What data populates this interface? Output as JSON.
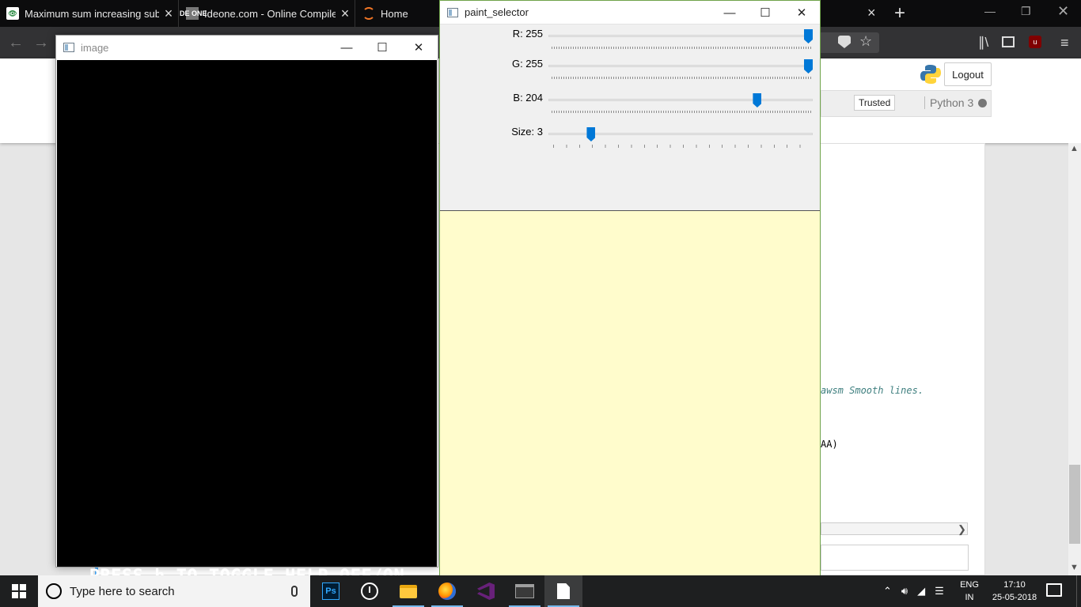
{
  "browser": {
    "tabs": [
      {
        "label": "Maximum sum increasing subs",
        "favicon": "gfg-icon"
      },
      {
        "label": "Ideone.com - Online Compiler",
        "favicon": "ideone-icon"
      },
      {
        "label": "Home",
        "favicon": "jupyter-icon"
      }
    ],
    "tab_close_glyph": "×",
    "new_tab_glyph": "+",
    "ideone_favicon_text": "IDE ONE"
  },
  "jupyter": {
    "logout_label": "Logout",
    "trusted_label": "Trusted",
    "kernel_name": "Python 3",
    "code_comment": "awsm Smooth lines.",
    "code_fragment": "AA)"
  },
  "image_window": {
    "title": "image",
    "help_text": "PRESS h TO TOGGLE  HELP OFF/ON",
    "canvas_color": "#000000"
  },
  "paint_window": {
    "title": "paint_selector",
    "trackbars": [
      {
        "label": "R: 255",
        "value": 255,
        "max": 255,
        "ticks": "dense"
      },
      {
        "label": "G: 255",
        "value": 255,
        "max": 255,
        "ticks": "dense"
      },
      {
        "label": "B: 204",
        "value": 204,
        "max": 255,
        "ticks": "dense"
      },
      {
        "label": "Size: 3",
        "value": 3,
        "max": 20,
        "ticks": "sparse"
      }
    ],
    "preview_color": "#fffccc"
  },
  "taskbar": {
    "search_placeholder": "Type here to search",
    "ps_label": "Ps",
    "apps": [
      "photoshop-icon",
      "alarms-icon",
      "file-explorer-icon",
      "firefox-icon",
      "visual-studio-icon",
      "terminal-icon",
      "notepad-icon"
    ],
    "language": "ENG",
    "region": "IN",
    "time": "17:10",
    "date": "25-05-2018"
  },
  "colors": {
    "accent": "#0078d7",
    "taskbar": "#1e1f20",
    "browser_chrome": "#0c0c0d"
  }
}
